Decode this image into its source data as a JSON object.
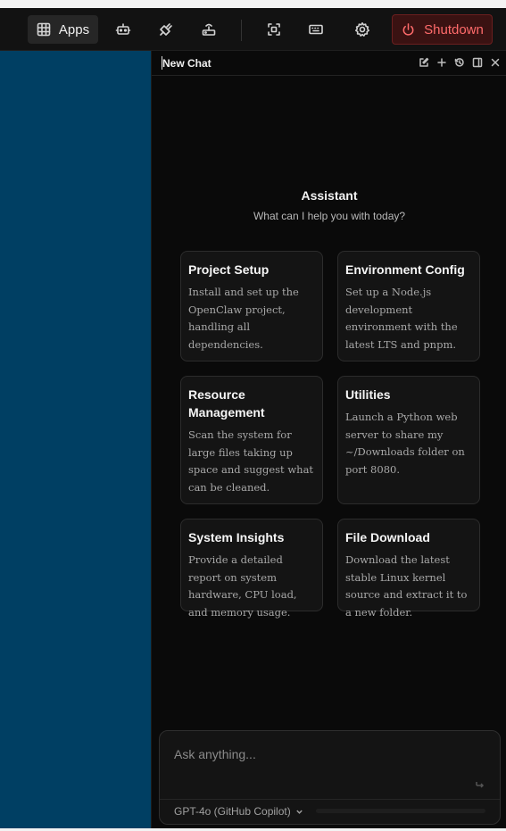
{
  "toolbar": {
    "apps_label": "Apps",
    "shutdown_label": "Shutdown",
    "icons": [
      "grid-icon",
      "robot-icon",
      "plug-icon",
      "router-icon",
      "screenshot-icon",
      "keyboard-icon",
      "gear-icon",
      "power-icon"
    ]
  },
  "chat": {
    "title": "New Chat",
    "header_icons": [
      "edit-icon",
      "plus-icon",
      "history-icon",
      "panel-icon",
      "close-icon"
    ],
    "assistant_title": "Assistant",
    "assistant_subtitle": "What can I help you with today?",
    "cards": [
      {
        "title": "Project Setup",
        "desc": "Install and set up the OpenClaw project, handling all dependencies."
      },
      {
        "title": "Environment Config",
        "desc": "Set up a Node.js development environment with the latest LTS and pnpm."
      },
      {
        "title": "Resource Management",
        "desc": "Scan the system for large files taking up space and suggest what can be cleaned."
      },
      {
        "title": "Utilities",
        "desc": "Launch a Python web server to share my ~/Downloads folder on port 8080."
      },
      {
        "title": "System Insights",
        "desc": "Provide a detailed report on system hardware, CPU load, and memory usage."
      },
      {
        "title": "File Download",
        "desc": "Download the latest stable Linux kernel source and extract it to a new folder."
      }
    ],
    "input_placeholder": "Ask anything...",
    "model_label": "GPT-4o (GitHub Copilot)"
  },
  "colors": {
    "left_pane": "#003f63",
    "shutdown_text": "#ff6b6b",
    "panel_bg": "#0a0a0a"
  }
}
